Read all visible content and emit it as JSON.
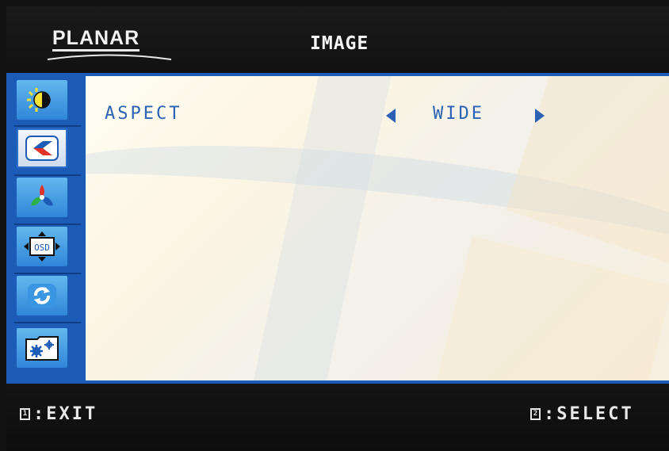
{
  "header": {
    "brand": "PLANAR",
    "title": "IMAGE"
  },
  "sidebar": {
    "items": [
      {
        "icon": "brightness-contrast-icon",
        "selected": false
      },
      {
        "icon": "image-settings-icon",
        "selected": true
      },
      {
        "icon": "color-icon",
        "selected": false
      },
      {
        "icon": "osd-position-icon",
        "selected": false
      },
      {
        "icon": "reset-icon",
        "selected": false
      },
      {
        "icon": "advanced-settings-icon",
        "selected": false
      }
    ]
  },
  "content": {
    "setting_label": "ASPECT",
    "setting_value": "WIDE"
  },
  "footer": {
    "exit_key": "1",
    "exit_label": ":EXIT",
    "select_key": "2",
    "select_label": ":SELECT"
  },
  "colors": {
    "accent_blue": "#1c5cb6",
    "text_blue": "#2b62b4",
    "background_dark": "#111111"
  }
}
